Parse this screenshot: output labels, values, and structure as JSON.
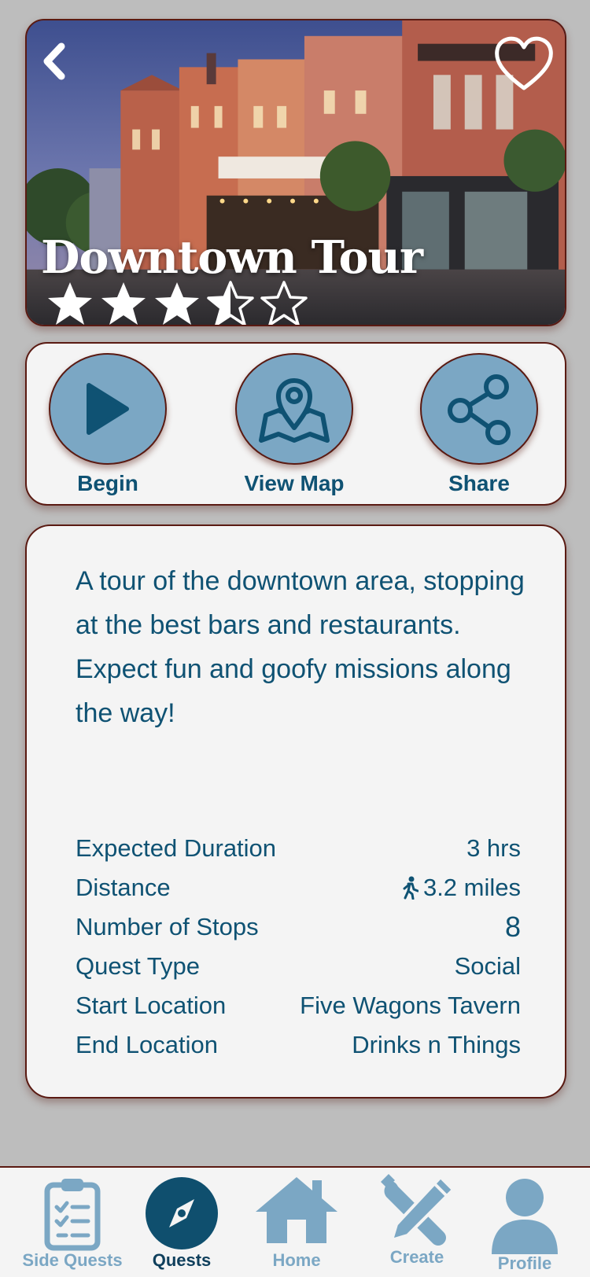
{
  "hero": {
    "title": "Downtown Tour",
    "rating": 3.5,
    "max_rating": 5,
    "back_icon": "chevron-left-icon",
    "favorite_icon": "heart-outline-icon"
  },
  "actions": [
    {
      "label": "Begin",
      "icon": "play-icon"
    },
    {
      "label": "View Map",
      "icon": "map-pin-icon"
    },
    {
      "label": "Share",
      "icon": "share-icon"
    }
  ],
  "details": {
    "description": "A tour of the downtown area, stopping at the best bars and restaurants. Expect fun and goofy missions along the way!",
    "rows": [
      {
        "label": "Expected Duration",
        "value": "3 hrs"
      },
      {
        "label": "Distance",
        "value": "3.2 miles",
        "icon": "walking-icon"
      },
      {
        "label": "Number of Stops",
        "value": "8"
      },
      {
        "label": "Quest Type",
        "value": "Social"
      },
      {
        "label": "Start Location",
        "value": "Five Wagons Tavern"
      },
      {
        "label": "End Location",
        "value": "Drinks n Things"
      }
    ]
  },
  "nav": {
    "items": [
      {
        "label": "Side Quests",
        "icon": "clipboard-checklist-icon",
        "active": false
      },
      {
        "label": "Quests",
        "icon": "compass-icon",
        "active": true
      },
      {
        "label": "Home",
        "icon": "home-icon",
        "active": false
      },
      {
        "label": "Create",
        "icon": "tools-icon",
        "active": false
      },
      {
        "label": "Profile",
        "icon": "user-icon",
        "active": false
      }
    ]
  },
  "colors": {
    "primary": "#0f5273",
    "accent": "#7ba7c4",
    "border": "#5a1a12",
    "card": "#f4f4f4",
    "background": "#bdbdbd"
  }
}
